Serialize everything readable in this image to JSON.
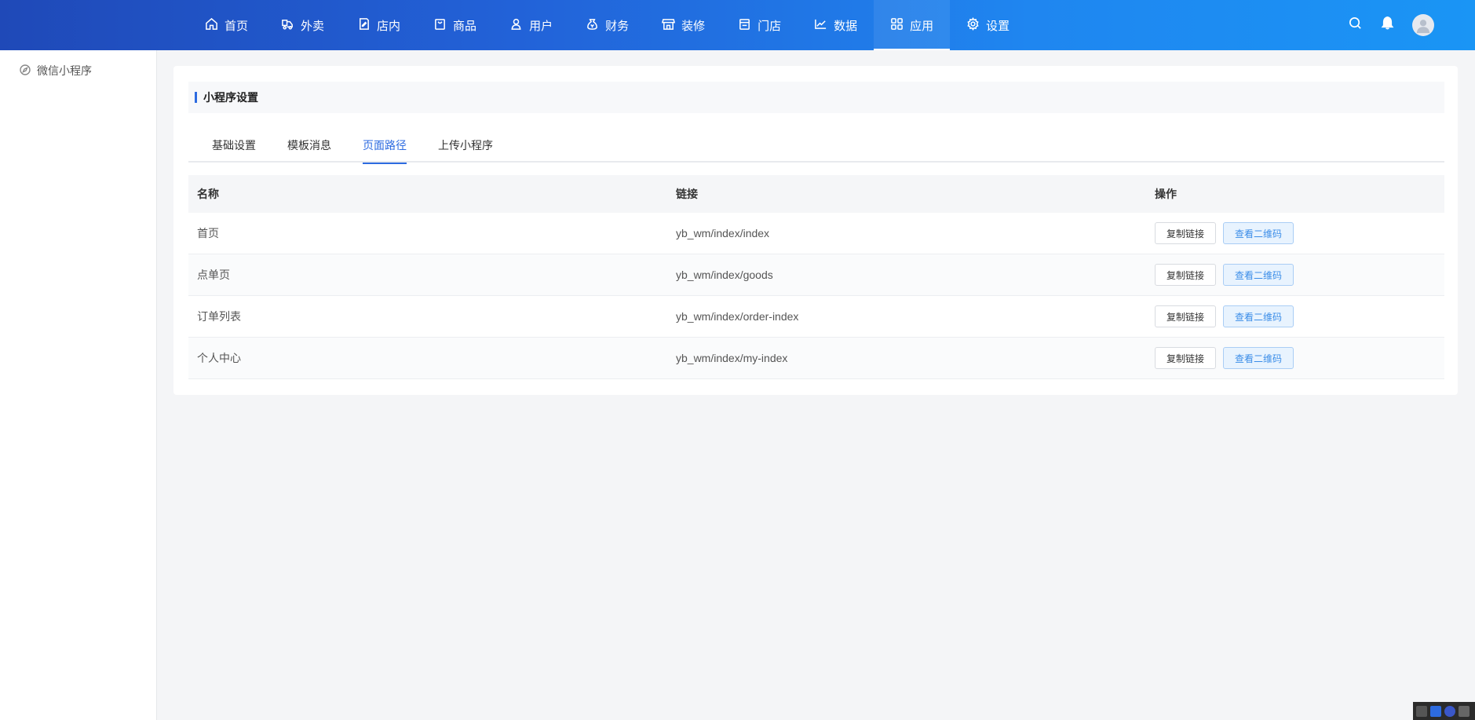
{
  "nav": {
    "items": [
      {
        "label": "首页",
        "icon": "home-icon"
      },
      {
        "label": "外卖",
        "icon": "delivery-icon"
      },
      {
        "label": "店内",
        "icon": "store-edit-icon"
      },
      {
        "label": "商品",
        "icon": "bag-icon"
      },
      {
        "label": "用户",
        "icon": "user-icon"
      },
      {
        "label": "财务",
        "icon": "money-bag-icon"
      },
      {
        "label": "装修",
        "icon": "storefront-icon"
      },
      {
        "label": "门店",
        "icon": "shop-icon"
      },
      {
        "label": "数据",
        "icon": "chart-icon"
      },
      {
        "label": "应用",
        "icon": "apps-icon"
      },
      {
        "label": "设置",
        "icon": "gear-icon"
      }
    ],
    "active_index": 9
  },
  "sidebar": {
    "items": [
      {
        "label": "微信小程序",
        "icon": "compass-icon"
      }
    ]
  },
  "section": {
    "title": "小程序设置"
  },
  "tabs": {
    "items": [
      "基础设置",
      "模板消息",
      "页面路径",
      "上传小程序"
    ],
    "active_index": 2
  },
  "table": {
    "headers": [
      "名称",
      "链接",
      "操作"
    ],
    "rows": [
      {
        "name": "首页",
        "link": "yb_wm/index/index"
      },
      {
        "name": "点单页",
        "link": "yb_wm/index/goods"
      },
      {
        "name": "订单列表",
        "link": "yb_wm/index/order-index"
      },
      {
        "name": "个人中心",
        "link": "yb_wm/index/my-index"
      }
    ],
    "copy_label": "复制链接",
    "qr_label": "查看二维码"
  },
  "colors": {
    "accent": "#2d6be0",
    "topbar_start": "#1f49b8",
    "topbar_end": "#1a95f5"
  }
}
